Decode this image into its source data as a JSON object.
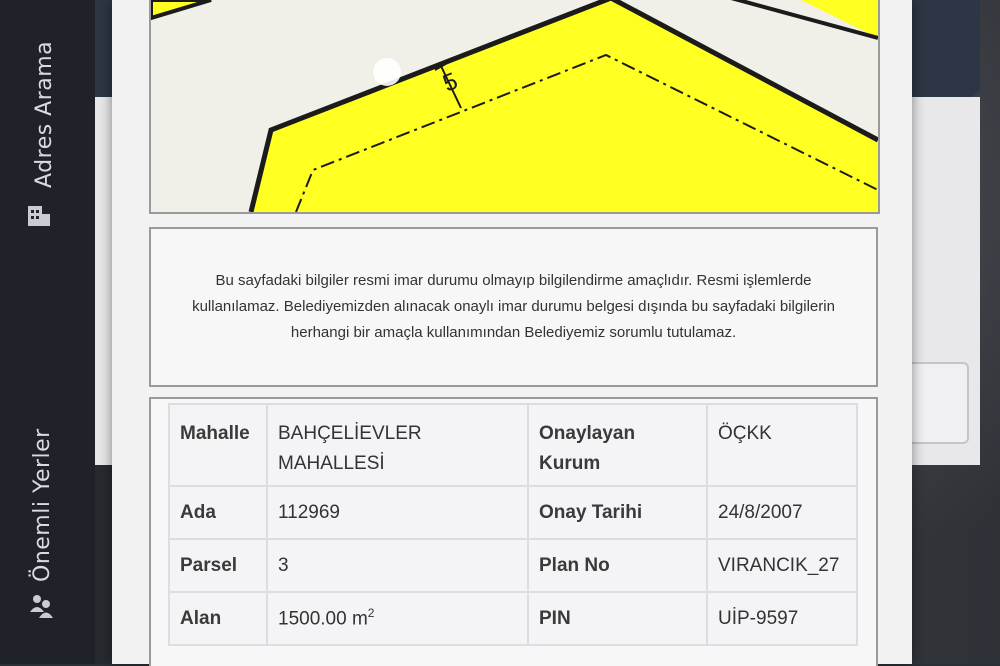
{
  "sidebar": {
    "tabs": [
      {
        "label": "Adres Arama",
        "icon": "building-icon"
      },
      {
        "label": "Önemli Yerler",
        "icon": "people-icon"
      }
    ]
  },
  "plan_map": {
    "setback_label": "5",
    "colors": {
      "parcel_fill": "#ffff22",
      "background": "#f0efe8",
      "boundary": "#1b1b1b"
    }
  },
  "notice": {
    "text": "Bu sayfadaki bilgiler resmi imar durumu olmayıp bilgilendirme amaçlıdır. Resmi işlemlerde kullanılamaz. Belediyemizden alınacak onaylı imar durumu belgesi dışında bu sayfadaki bilgilerin herhangi bir amaçla kullanımından Belediyemiz sorumlu tutulamaz."
  },
  "info_table": {
    "rows": [
      {
        "k1": "Mahalle",
        "v1": "BAHÇELİEVLER MAHALLESİ",
        "k2": "Onaylayan Kurum",
        "v2": "ÖÇKK"
      },
      {
        "k1": "Ada",
        "v1": "112969",
        "k2": "Onay Tarihi",
        "v2": "24/8/2007"
      },
      {
        "k1": "Parsel",
        "v1": "3",
        "k2": "Plan No",
        "v2": "VIRANCIK_27"
      },
      {
        "k1": "Alan",
        "v1": "1500.00",
        "v1_unit": "m",
        "v1_sup": "2",
        "k2": "PIN",
        "v2": "UİP-9597"
      }
    ]
  }
}
